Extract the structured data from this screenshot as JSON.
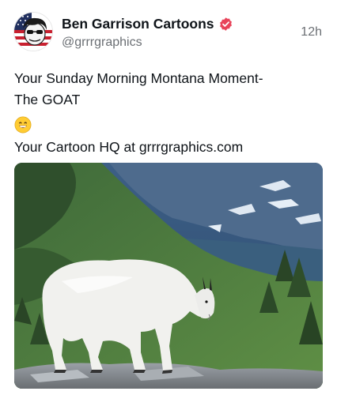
{
  "author": {
    "display_name": "Ben Garrison Cartoons",
    "handle": "@grrrgraphics",
    "verified_badge_icon": "verified-badge-icon",
    "badge_color": "#e8445a"
  },
  "post": {
    "timestamp": "12h",
    "lines": [
      "Your Sunday Morning Montana Moment-",
      "The GOAT",
      "Your Cartoon HQ at grrrgraphics.com"
    ],
    "emoji": "grinning-face-icon",
    "media_icon": "mountain-goat-photo"
  }
}
